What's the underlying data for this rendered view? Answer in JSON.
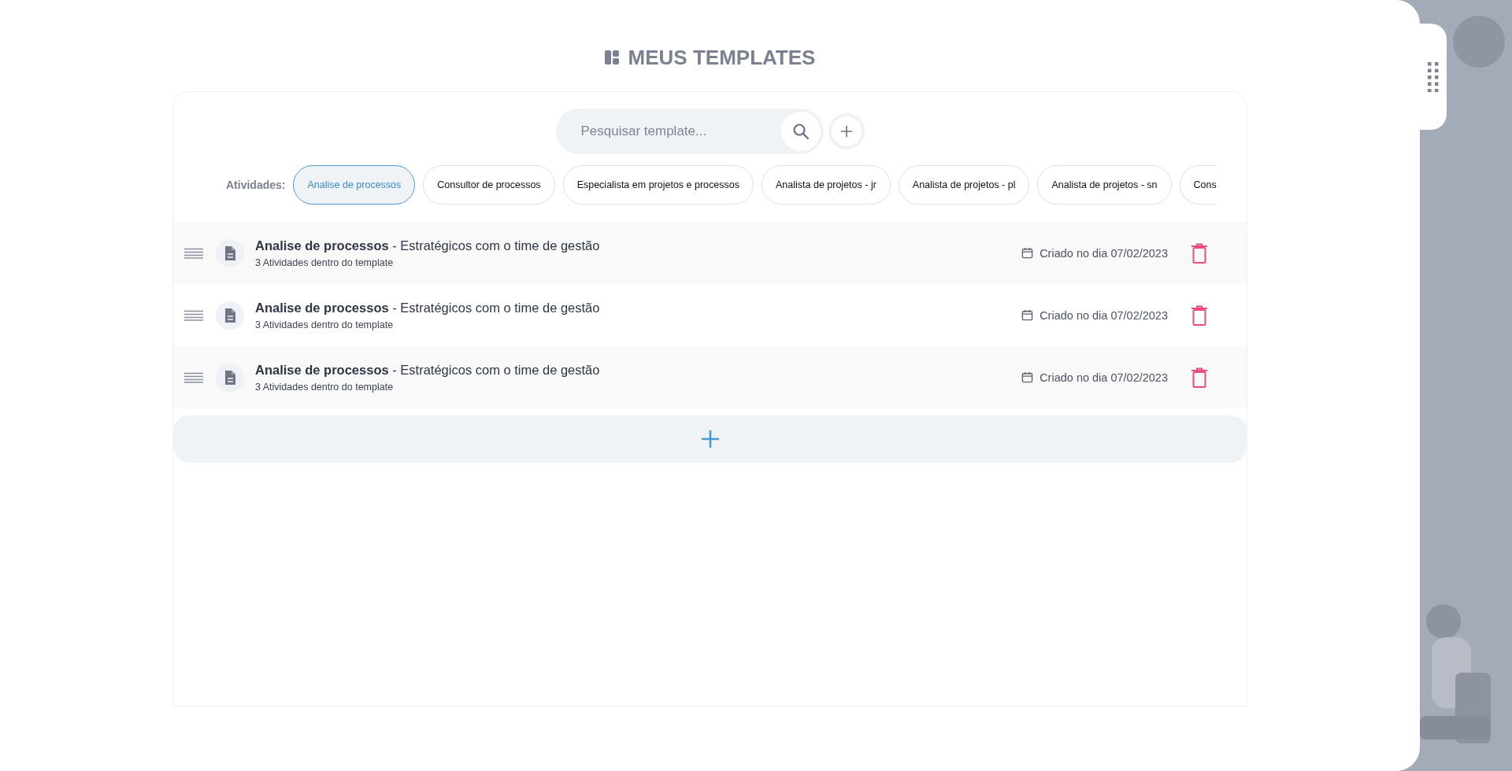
{
  "header": {
    "title": "MEUS TEMPLATES"
  },
  "search": {
    "placeholder": "Pesquisar template..."
  },
  "filters": {
    "label": "Atividades:",
    "chips": [
      {
        "label": "Analise de processos",
        "selected": true
      },
      {
        "label": "Consultor de processos",
        "selected": false
      },
      {
        "label": "Especialista em projetos e processos",
        "selected": false
      },
      {
        "label": "Analista de projetos - jr",
        "selected": false
      },
      {
        "label": "Analista de projetos - pl",
        "selected": false
      },
      {
        "label": "Analista de projetos - sn",
        "selected": false
      },
      {
        "label": "Cons",
        "selected": false
      }
    ]
  },
  "templates": [
    {
      "title": "**Analise de processos** - Estratégicos com o time de gestão",
      "subtitle": "3 Atividades dentro do template",
      "created": "Criado no dia 07/02/2023"
    },
    {
      "title": "**Analise de processos** - Estratégicos com o time de gestão",
      "subtitle": "3 Atividades dentro do template",
      "created": "Criado no dia 07/02/2023"
    },
    {
      "title": "**Analise de processos** - Estratégicos com o time de gestão",
      "subtitle": "3 Atividades dentro do template",
      "created": "Criado no dia 07/02/2023"
    }
  ]
}
